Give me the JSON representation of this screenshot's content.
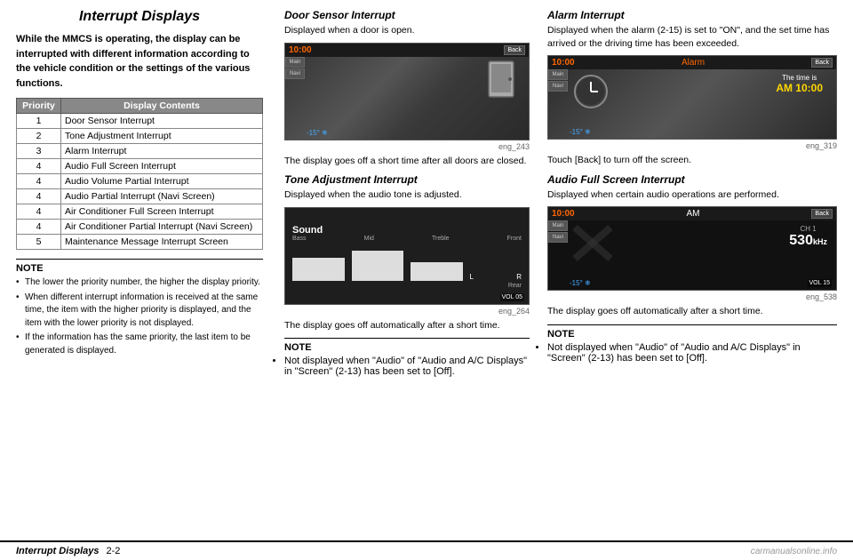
{
  "page": {
    "title": "Interrupt Displays",
    "intro": "While the MMCS is operating, the display can be interrupted with different information according to the vehicle condition or the settings of the various functions.",
    "table": {
      "col1_header": "Priority",
      "col2_header": "Display Contents",
      "rows": [
        {
          "priority": "1",
          "content": "Door Sensor Interrupt"
        },
        {
          "priority": "2",
          "content": "Tone Adjustment Interrupt"
        },
        {
          "priority": "3",
          "content": "Alarm Interrupt"
        },
        {
          "priority": "4",
          "content": "Audio Full Screen Interrupt"
        },
        {
          "priority": "4",
          "content2": "Audio Volume Partial Interrupt"
        },
        {
          "priority": "4",
          "content3": "Audio Partial Interrupt (Navi Screen)"
        },
        {
          "priority": "4",
          "content4": "Air Conditioner Full Screen Interrupt"
        },
        {
          "priority": "4",
          "content5": "Air Conditioner Partial Interrupt (Navi Screen)"
        },
        {
          "priority": "5",
          "content6": "Maintenance Message Interrupt Screen"
        }
      ]
    },
    "note": {
      "title": "NOTE",
      "bullets": [
        "The lower the priority number, the higher the display priority.",
        "When different interrupt information is received at the same time, the item with the higher priority is displayed, and the item with the lower priority is not displayed.",
        "If the information has the same priority, the last item to be generated is displayed."
      ]
    }
  },
  "mid_col": {
    "door_section": {
      "title": "Door Sensor Interrupt",
      "desc": "Displayed when a door is open.",
      "caption": "eng_243",
      "after_text": "The display goes off a short time after all doors are closed."
    },
    "tone_section": {
      "title": "Tone Adjustment Interrupt",
      "desc": "Displayed when the audio tone is adjusted.",
      "caption": "eng_264",
      "after_text": "The display goes off automatically after a short time.",
      "note_title": "NOTE",
      "note_bullet": "Not displayed when \"Audio\" of \"Audio and A/C Displays\" in \"Screen\" (2-13) has been set to [Off]."
    }
  },
  "right_col": {
    "alarm_section": {
      "title": "Alarm Interrupt",
      "desc": "Displayed when the alarm (2-15) is set to \"ON\", and the set time has arrived or the driving time has been exceeded.",
      "caption": "eng_319",
      "after_text": "Touch [Back] to turn off the screen."
    },
    "audio_section": {
      "title": "Audio Full Screen Interrupt",
      "desc": "Displayed when certain audio operations are performed.",
      "caption": "eng_538",
      "after_text": "The display goes off automatically after a short time.",
      "note_title": "NOTE",
      "note_bullet": "Not displayed when \"Audio\" of \"Audio and A/C Displays\" in \"Screen\" (2-13) has been set to [Off]."
    }
  },
  "footer": {
    "section_label": "Interrupt Displays",
    "page_number": "2-2",
    "watermark": "carmanualsonline.info"
  }
}
